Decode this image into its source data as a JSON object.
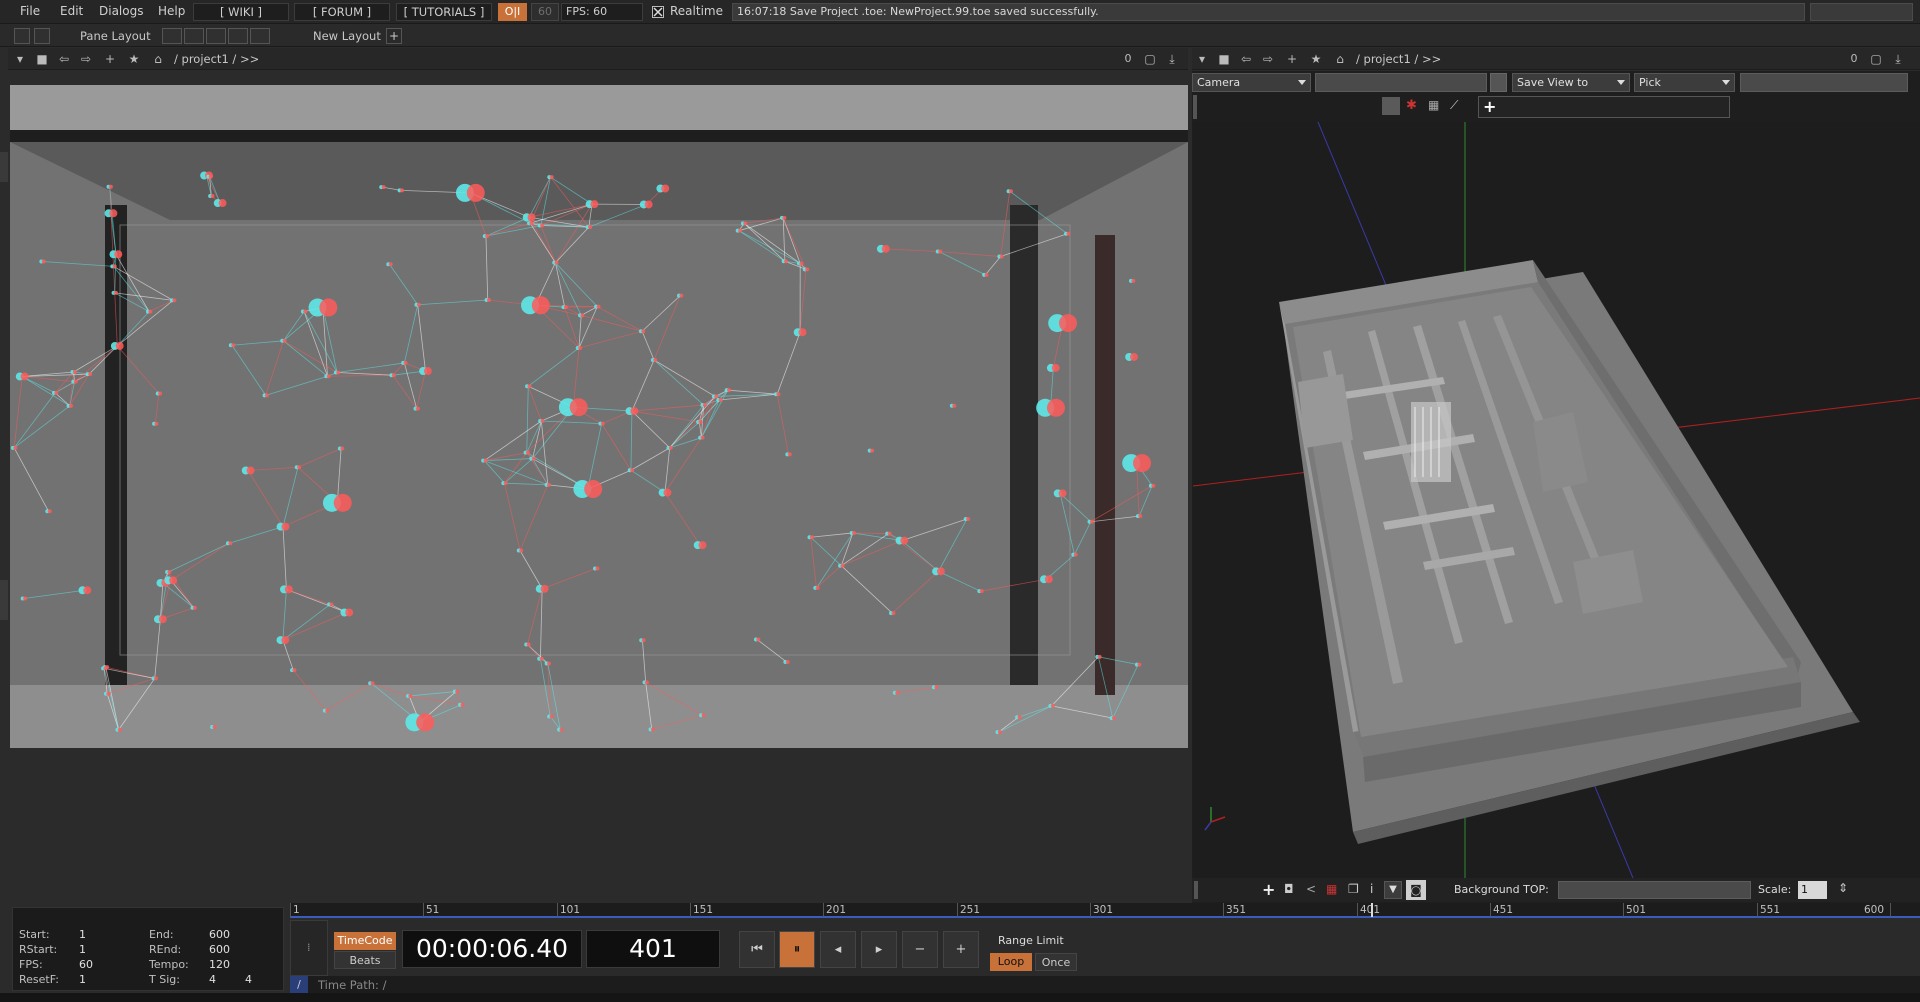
{
  "menu": {
    "items": [
      "File",
      "Edit",
      "Dialogs",
      "Help"
    ],
    "wiki": "[ WIKI ]",
    "forum": "[ FORUM ]",
    "tutorials": "[ TUTORIALS ]",
    "oi": "O|I",
    "sixty": "60",
    "fps_label": "FPS:  60",
    "realtime": "Realtime",
    "status": "16:07:18 Save Project .toe: NewProject.99.toe saved successfully."
  },
  "layoutbar": {
    "pane_layout": "Pane Layout",
    "new_layout": "New Layout"
  },
  "left_pane": {
    "path": "/ project1 / >>",
    "counter": "0"
  },
  "right_pane": {
    "path": "/ project1 / >>",
    "counter": "0",
    "camera": "Camera",
    "save_view": "Save View to",
    "pick": "Pick",
    "background_top_label": "Background TOP:",
    "scale_label": "Scale:",
    "scale_value": "1"
  },
  "timeline": {
    "ticks": [
      "1",
      "51",
      "101",
      "151",
      "201",
      "251",
      "301",
      "351",
      "401",
      "451",
      "501",
      "551",
      "600"
    ],
    "current_frame": "401"
  },
  "info": {
    "start_label": "Start:",
    "start": "1",
    "end_label": "End:",
    "end": "600",
    "rstart_label": "RStart:",
    "rstart": "1",
    "rend_label": "REnd:",
    "rend": "600",
    "fps_label": "FPS:",
    "fps": "60",
    "tempo_label": "Tempo:",
    "tempo": "120",
    "resetf_label": "ResetF:",
    "resetf": "1",
    "tsig_label": "T Sig:",
    "tsig_a": "4",
    "tsig_b": "4"
  },
  "transport": {
    "timecode": "TimeCode",
    "beats": "Beats",
    "time": "00:00:06.40",
    "frame": "401",
    "range_limit": "Range Limit",
    "loop": "Loop",
    "once": "Once"
  },
  "timepath": {
    "label": "Time Path: /"
  },
  "colors": {
    "accent": "#c8723a",
    "timeline_blue": "#3a5cbf"
  }
}
